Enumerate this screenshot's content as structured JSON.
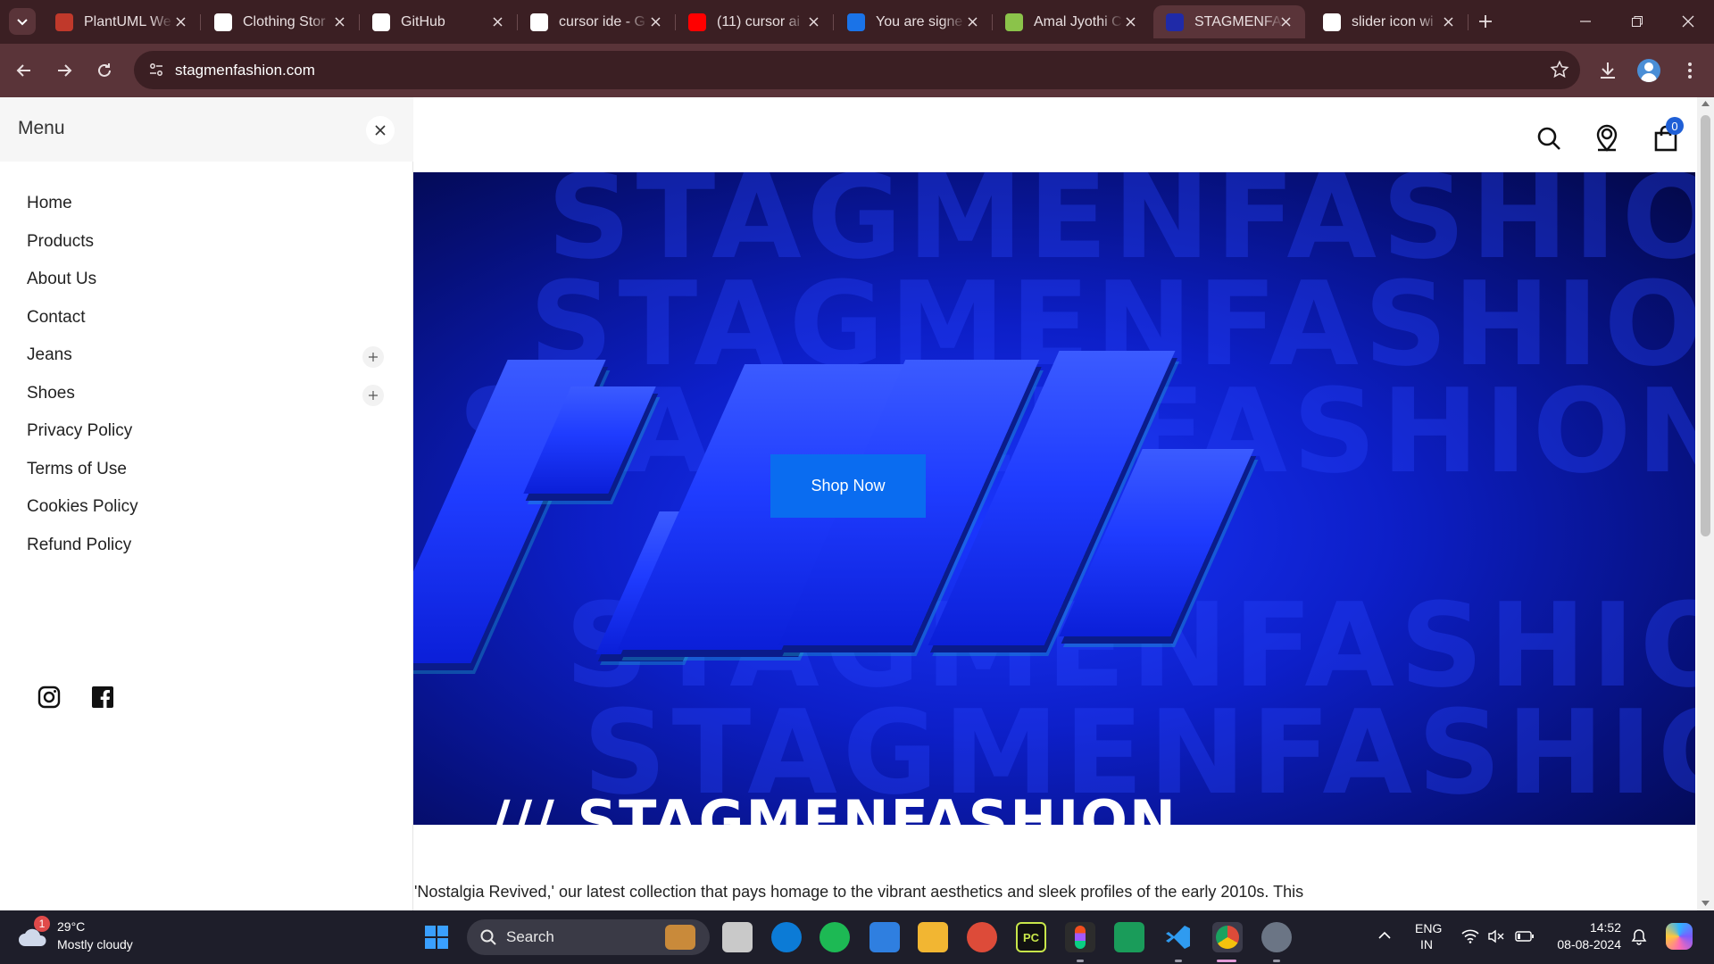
{
  "browser": {
    "tabs": [
      {
        "title": "PlantUML We",
        "favicon_color": "#c0392b"
      },
      {
        "title": "Clothing Stor",
        "favicon_color": "#ffffff"
      },
      {
        "title": "GitHub",
        "favicon_color": "#ffffff"
      },
      {
        "title": "cursor ide - G",
        "favicon_color": "#ffffff"
      },
      {
        "title": "(11) cursor ai",
        "favicon_color": "#ff0000"
      },
      {
        "title": "You are signe",
        "favicon_color": "#1a73e8"
      },
      {
        "title": "Amal Jyothi C",
        "favicon_color": "#8bc34a"
      },
      {
        "title": "STAGMENFAS",
        "favicon_color": "#1f2aa8"
      },
      {
        "title": "slider icon wi",
        "favicon_color": "#ffffff"
      }
    ],
    "active_tab_index": 7,
    "url": "stagmenfashion.com"
  },
  "site": {
    "cart_count": "0",
    "hero": {
      "button_label": "Shop Now",
      "brand_text": "/// STAGMENFASHION",
      "bg_words": [
        "STAGMENFASHION",
        "STAGMENFASHION",
        "STAGMENFASHION",
        "STAGMENFASHION",
        "STAGMENFASHION"
      ]
    },
    "intro_text": "'Nostalgia Revived,' our latest collection that pays homage to the vibrant aesthetics and sleek profiles of the early 2010s. This"
  },
  "menu": {
    "title": "Menu",
    "items": [
      {
        "label": "Home",
        "expandable": false
      },
      {
        "label": "Products",
        "expandable": false
      },
      {
        "label": "About Us",
        "expandable": false
      },
      {
        "label": "Contact",
        "expandable": false
      },
      {
        "label": "Jeans",
        "expandable": true
      },
      {
        "label": "Shoes",
        "expandable": true
      },
      {
        "label": "Privacy Policy",
        "expandable": false
      },
      {
        "label": "Terms of Use",
        "expandable": false
      },
      {
        "label": "Cookies Policy",
        "expandable": false
      },
      {
        "label": "Refund Policy",
        "expandable": false
      }
    ],
    "social": [
      "instagram-icon",
      "facebook-icon"
    ]
  },
  "taskbar": {
    "weather_temp": "29°C",
    "weather_cond": "Mostly cloudy",
    "weather_badge": "1",
    "search_label": "Search",
    "lang_top": "ENG",
    "lang_bottom": "IN",
    "time": "14:52",
    "date": "08-08-2024"
  }
}
